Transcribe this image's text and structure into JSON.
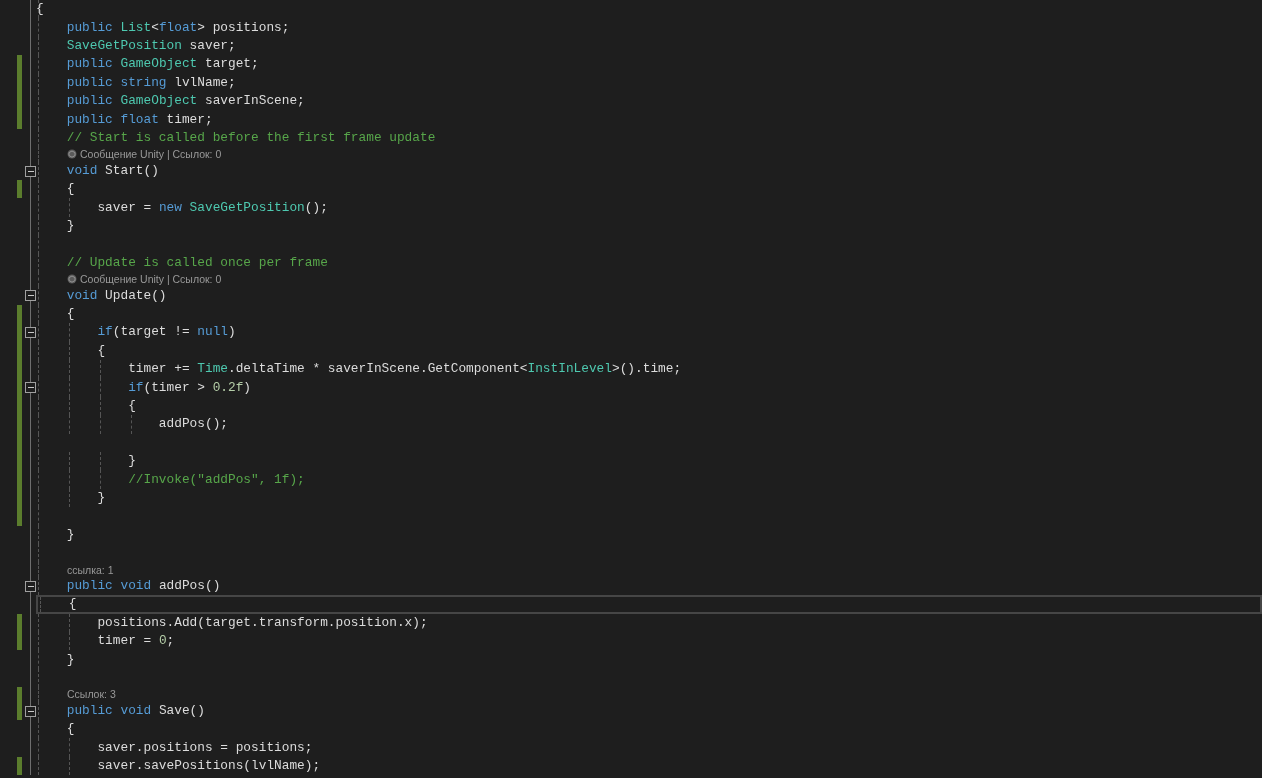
{
  "editor": {
    "lines": [
      {
        "kind": "code",
        "tokens": [
          {
            "plain": "{"
          }
        ]
      },
      {
        "kind": "code",
        "tokens": [
          {
            "kw": "    public "
          },
          {
            "type": "List"
          },
          {
            "plain": "<"
          },
          {
            "kw": "float"
          },
          {
            "plain": "> positions;"
          }
        ]
      },
      {
        "kind": "code",
        "tokens": [
          {
            "type": "    SaveGetPosition"
          },
          {
            "plain": " saver;"
          }
        ]
      },
      {
        "kind": "code",
        "changed": true,
        "tokens": [
          {
            "kw": "    public "
          },
          {
            "type": "GameObject"
          },
          {
            "plain": " target;"
          }
        ]
      },
      {
        "kind": "code",
        "changed": true,
        "tokens": [
          {
            "kw": "    public string"
          },
          {
            "plain": " lvlName;"
          }
        ]
      },
      {
        "kind": "code",
        "changed": true,
        "tokens": [
          {
            "kw": "    public "
          },
          {
            "type": "GameObject"
          },
          {
            "plain": " saverInScene;"
          }
        ]
      },
      {
        "kind": "code",
        "changed": true,
        "tokens": [
          {
            "kw": "    public float"
          },
          {
            "plain": " timer;"
          }
        ]
      },
      {
        "kind": "code",
        "tokens": [
          {
            "comment": "    // Start is called before the first frame update"
          }
        ]
      },
      {
        "kind": "unity_lens",
        "text": "Сообщение Unity | Ссылок: 0"
      },
      {
        "kind": "code",
        "fold": true,
        "tokens": [
          {
            "kw": "    void"
          },
          {
            "plain": " Start()"
          }
        ]
      },
      {
        "kind": "code",
        "changed": true,
        "tokens": [
          {
            "plain": "    {"
          }
        ]
      },
      {
        "kind": "code",
        "tokens": [
          {
            "plain": "        saver = "
          },
          {
            "kw": "new "
          },
          {
            "type": "SaveGetPosition"
          },
          {
            "plain": "();"
          }
        ]
      },
      {
        "kind": "code",
        "tokens": [
          {
            "plain": "    }"
          }
        ]
      },
      {
        "kind": "code"
      },
      {
        "kind": "code",
        "tokens": [
          {
            "comment": "    // Update is called once per frame"
          }
        ]
      },
      {
        "kind": "unity_lens",
        "text": "Сообщение Unity | Ссылок: 0"
      },
      {
        "kind": "code",
        "fold": true,
        "tokens": [
          {
            "kw": "    void"
          },
          {
            "plain": " Update()"
          }
        ]
      },
      {
        "kind": "code",
        "changed": true,
        "tokens": [
          {
            "plain": "    {"
          }
        ]
      },
      {
        "kind": "code",
        "changed": true,
        "fold": true,
        "tokens": [
          {
            "kw": "        if"
          },
          {
            "plain": "(target != "
          },
          {
            "kw": "null"
          },
          {
            "plain": ")"
          }
        ]
      },
      {
        "kind": "code",
        "changed": true,
        "tokens": [
          {
            "plain": "        {"
          }
        ]
      },
      {
        "kind": "code",
        "changed": true,
        "tokens": [
          {
            "plain": "            timer += "
          },
          {
            "type": "Time"
          },
          {
            "plain": ".deltaTime * saverInScene.GetComponent<"
          },
          {
            "type": "InstInLevel"
          },
          {
            "plain": ">().time;"
          }
        ]
      },
      {
        "kind": "code",
        "changed": true,
        "fold": true,
        "tokens": [
          {
            "kw": "            if"
          },
          {
            "plain": "(timer > "
          },
          {
            "num": "0.2f"
          },
          {
            "plain": ")"
          }
        ]
      },
      {
        "kind": "code",
        "changed": true,
        "tokens": [
          {
            "plain": "            {"
          }
        ]
      },
      {
        "kind": "code",
        "changed": true,
        "tokens": [
          {
            "plain": "                addPos();"
          }
        ]
      },
      {
        "kind": "code",
        "changed": true
      },
      {
        "kind": "code",
        "changed": true,
        "tokens": [
          {
            "plain": "            }"
          }
        ]
      },
      {
        "kind": "code",
        "changed": true,
        "tokens": [
          {
            "comment": "            //Invoke(\"addPos\", 1f);"
          }
        ]
      },
      {
        "kind": "code",
        "changed": true,
        "tokens": [
          {
            "plain": "        }"
          }
        ]
      },
      {
        "kind": "code",
        "changed": true
      },
      {
        "kind": "code",
        "tokens": [
          {
            "plain": "    }"
          }
        ]
      },
      {
        "kind": "code"
      },
      {
        "kind": "lens",
        "text": "ссылка: 1"
      },
      {
        "kind": "code",
        "fold": true,
        "tokens": [
          {
            "kw": "    public void"
          },
          {
            "plain": " addPos()"
          }
        ]
      },
      {
        "kind": "code",
        "current": true,
        "tokens": [
          {
            "plain": "    {"
          }
        ]
      },
      {
        "kind": "code",
        "changed": true,
        "tokens": [
          {
            "plain": "        positions.Add(target.transform.position.x);"
          }
        ]
      },
      {
        "kind": "code",
        "changed": true,
        "tokens": [
          {
            "plain": "        timer = "
          },
          {
            "num": "0"
          },
          {
            "plain": ";"
          }
        ]
      },
      {
        "kind": "code",
        "tokens": [
          {
            "plain": "    }"
          }
        ]
      },
      {
        "kind": "code"
      },
      {
        "kind": "lens",
        "changed": true,
        "text": "Ссылок: 3"
      },
      {
        "kind": "code",
        "changed": true,
        "fold": true,
        "tokens": [
          {
            "kw": "    public void"
          },
          {
            "plain": " Save()"
          }
        ]
      },
      {
        "kind": "code",
        "tokens": [
          {
            "plain": "    {"
          }
        ]
      },
      {
        "kind": "code",
        "tokens": [
          {
            "plain": "        saver.positions = positions;"
          }
        ]
      },
      {
        "kind": "code",
        "changed": true,
        "tokens": [
          {
            "plain": "        saver.savePositions(lvlName);"
          }
        ]
      }
    ]
  }
}
